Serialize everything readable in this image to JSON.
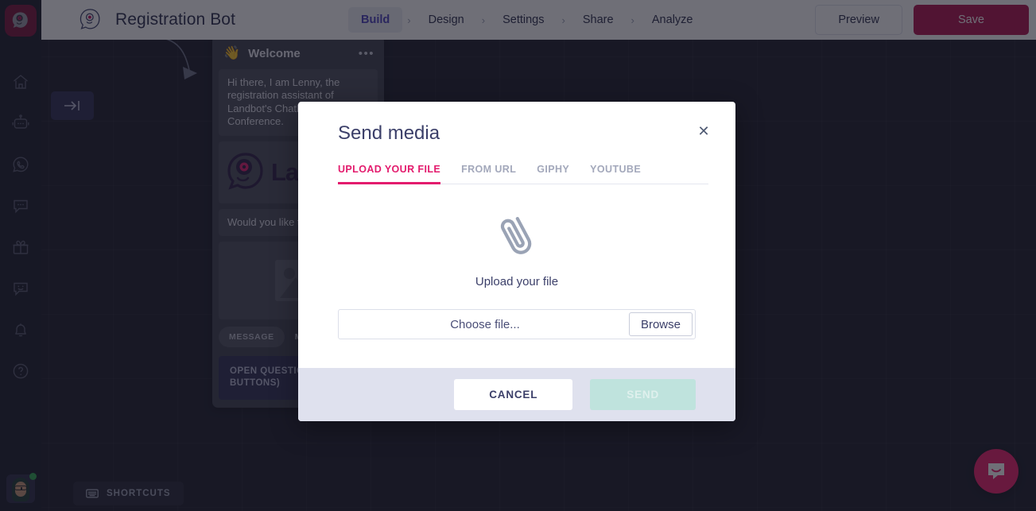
{
  "app": {
    "logo_icon": "landbot-mascot-icon",
    "bot_name": "Registration Bot"
  },
  "topnav": {
    "steps": [
      {
        "label": "Build",
        "active": true
      },
      {
        "label": "Design",
        "active": false
      },
      {
        "label": "Settings",
        "active": false
      },
      {
        "label": "Share",
        "active": false
      },
      {
        "label": "Analyze",
        "active": false
      }
    ],
    "separator": "›",
    "preview_label": "Preview",
    "save_label": "Save",
    "save_color": "#b0124c"
  },
  "sidebar": {
    "items": [
      {
        "name": "home-icon",
        "label": "Home"
      },
      {
        "name": "bot-icon",
        "label": "Bots"
      },
      {
        "name": "whatsapp-icon",
        "label": "WhatsApp"
      },
      {
        "name": "chat-icon",
        "label": "Messages"
      },
      {
        "name": "gift-icon",
        "label": "Rewards"
      },
      {
        "name": "smiley-chat-icon",
        "label": "Feedback"
      },
      {
        "name": "bell-icon",
        "label": "Notifications"
      },
      {
        "name": "help-icon",
        "label": "Help"
      }
    ],
    "avatar_status": "online"
  },
  "canvas": {
    "collapse_icon": "collapse-panel-icon",
    "shortcuts_label": "SHORTCUTS",
    "shortcuts_icon": "keyboard-icon"
  },
  "flow_card": {
    "emoji": "👋",
    "title": "Welcome",
    "menu_icon": "more-options-icon",
    "message_1": "Hi there, I am Lenny, the registration assistant of Landbot's Chatbot and AI Conference.",
    "logo_text": "Lan",
    "message_2": "Would you like to register?",
    "image_placeholder_icon": "image-placeholder-icon",
    "tabs": [
      {
        "label": "MESSAGE",
        "active": false
      },
      {
        "label": "MEDIA",
        "active": true
      }
    ],
    "open_question_label": "OPEN QUESTION (NO BUTTONS)"
  },
  "modal": {
    "title": "Send media",
    "close_icon": "close-icon",
    "tabs": [
      {
        "label": "UPLOAD YOUR FILE",
        "active": true
      },
      {
        "label": "FROM URL",
        "active": false
      },
      {
        "label": "GIPHY",
        "active": false
      },
      {
        "label": "YOUTUBE",
        "active": false
      }
    ],
    "active_tab_color": "#e31b6d",
    "upload_icon": "paperclip-icon",
    "upload_label": "Upload your file",
    "file_placeholder": "Choose file...",
    "browse_label": "Browse",
    "cancel_label": "CANCEL",
    "send_label": "SEND",
    "send_disabled": true
  },
  "intercom": {
    "icon": "intercom-chat-icon",
    "color": "#ec1d69"
  }
}
